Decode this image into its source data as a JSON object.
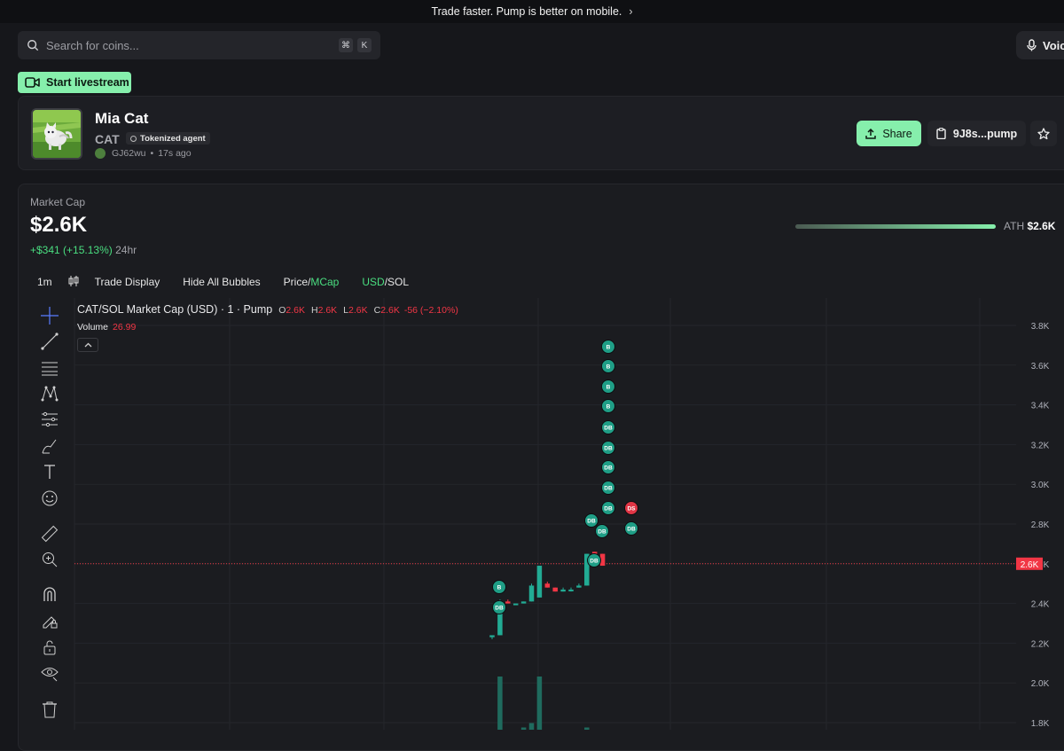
{
  "topbar": {
    "promo": "Trade faster. Pump is better on mobile."
  },
  "search": {
    "placeholder": "Search for coins...",
    "shortcut_keys": [
      "⌘",
      "K"
    ]
  },
  "voice_button": {
    "label": "Voic"
  },
  "livestream_button": {
    "label": "Start livestream"
  },
  "coin": {
    "name": "Mia Cat",
    "ticker": "CAT",
    "badge": "Tokenized agent",
    "creator": "GJ62wu",
    "age": "17s ago",
    "share_label": "Share",
    "address_label": "9J8s...pump"
  },
  "market": {
    "label": "Market Cap",
    "value": "$2.6K",
    "change": "+$341 (+15.13%)",
    "period": "24hr",
    "ath_label": "ATH",
    "ath_value": "$2.6K",
    "ath_progress": 1.0
  },
  "chart_toolbar": {
    "interval": "1m",
    "trade_display": "Trade Display",
    "hide_bubbles": "Hide All Bubbles",
    "price_label": "Price/",
    "mcap_label": "MCap",
    "usd_label": "USD",
    "sol_label": "/SOL"
  },
  "legend": {
    "title": "CAT/SOL Market Cap (USD) · 1 · Pump",
    "o_label": "O",
    "o_value": "2.6K",
    "h_label": "H",
    "h_value": "2.6K",
    "l_label": "L",
    "l_value": "2.6K",
    "c_label": "C",
    "c_value": "2.6K",
    "change": "-56 (−2.10%)",
    "volume_label": "Volume",
    "volume_value": "26.99"
  },
  "colors": {
    "up": "#22ab94",
    "down": "#f23645",
    "accent": "#86efac"
  },
  "chart_data": {
    "type": "candlestick",
    "y_ticks": [
      "3.8K",
      "3.6K",
      "3.4K",
      "3.2K",
      "3.0K",
      "2.8K",
      "2.6K",
      "2.4K",
      "2.2K",
      "2.0K",
      "1.8K"
    ],
    "ylim": [
      1800,
      3800
    ],
    "current_price_label": "2.6K",
    "current_price": 2600,
    "candles": [
      {
        "o": 2230,
        "h": 2240,
        "l": 2220,
        "c": 2240,
        "v": 0
      },
      {
        "o": 2240,
        "h": 2420,
        "l": 2240,
        "c": 2400,
        "v": 2.4
      },
      {
        "o": 2410,
        "h": 2420,
        "l": 2400,
        "c": 2400,
        "v": 0
      },
      {
        "o": 2400,
        "h": 2400,
        "l": 2400,
        "c": 2400,
        "v": 0
      },
      {
        "o": 2400,
        "h": 2410,
        "l": 2400,
        "c": 2410,
        "v": 0.1
      },
      {
        "o": 2410,
        "h": 2500,
        "l": 2410,
        "c": 2490,
        "v": 0.3
      },
      {
        "o": 2430,
        "h": 2590,
        "l": 2430,
        "c": 2590,
        "v": 2.4
      },
      {
        "o": 2500,
        "h": 2510,
        "l": 2480,
        "c": 2480,
        "v": 0
      },
      {
        "o": 2480,
        "h": 2480,
        "l": 2460,
        "c": 2460,
        "v": 0
      },
      {
        "o": 2460,
        "h": 2480,
        "l": 2460,
        "c": 2470,
        "v": 0
      },
      {
        "o": 2470,
        "h": 2480,
        "l": 2460,
        "c": 2470,
        "v": 0
      },
      {
        "o": 2480,
        "h": 2500,
        "l": 2480,
        "c": 2490,
        "v": 0
      },
      {
        "o": 2490,
        "h": 2650,
        "l": 2490,
        "c": 2650,
        "v": 0.1
      },
      {
        "o": 2660,
        "h": 2660,
        "l": 2650,
        "c": 2650,
        "v": 0
      },
      {
        "o": 2650,
        "h": 2650,
        "l": 2590,
        "c": 2590,
        "v": 0
      }
    ],
    "trade_bubbles": [
      {
        "label": "B",
        "side": "buy"
      },
      {
        "label": "DB",
        "side": "buy"
      },
      {
        "label": "B",
        "side": "buy"
      },
      {
        "label": "B",
        "side": "buy"
      },
      {
        "label": "B",
        "side": "buy"
      },
      {
        "label": "B",
        "side": "buy"
      },
      {
        "label": "DB",
        "side": "buy"
      },
      {
        "label": "DB",
        "side": "buy"
      },
      {
        "label": "DB",
        "side": "buy"
      },
      {
        "label": "DB",
        "side": "buy"
      },
      {
        "label": "DB",
        "side": "buy"
      },
      {
        "label": "DB",
        "side": "buy"
      },
      {
        "label": "DB",
        "side": "buy"
      },
      {
        "label": "DS",
        "side": "sell"
      },
      {
        "label": "DB",
        "side": "buy"
      },
      {
        "label": "DB",
        "side": "buy"
      }
    ]
  }
}
